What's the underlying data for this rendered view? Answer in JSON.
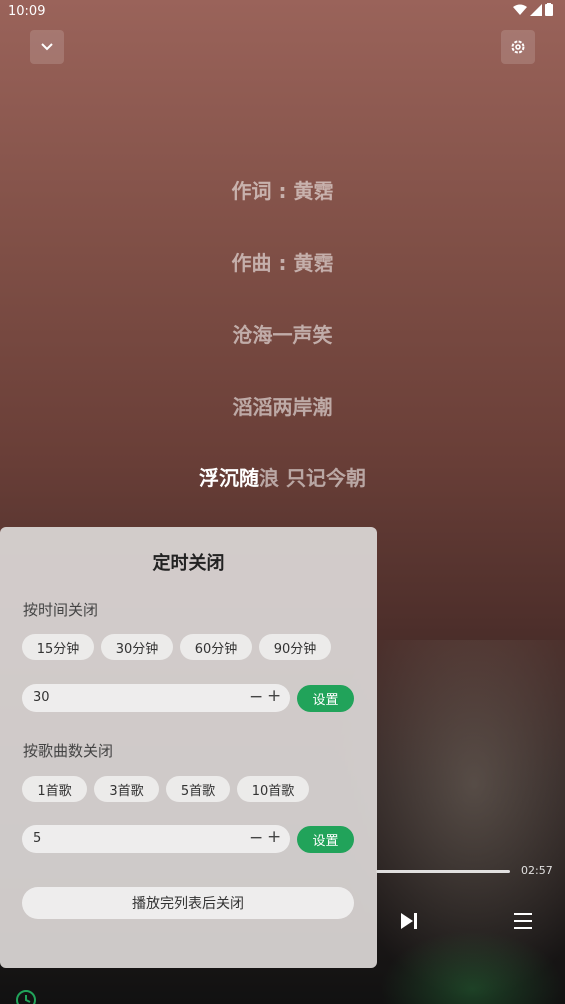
{
  "status_bar": {
    "time": "10:09"
  },
  "lyrics": {
    "lines": [
      "作词 : 黄霑",
      "作曲 : 黄霑",
      "沧海一声笑",
      "滔滔两岸潮"
    ],
    "current_sung": "浮沉随",
    "current_rest": "浪 只记今朝"
  },
  "player": {
    "duration": "02:57"
  },
  "timer_sheet": {
    "title": "定时关闭",
    "by_time": {
      "label": "按时间关闭",
      "chips": [
        "15分钟",
        "30分钟",
        "60分钟",
        "90分钟"
      ],
      "input_value": "30",
      "minus": "−",
      "plus": "+",
      "set_label": "设置"
    },
    "by_songs": {
      "label": "按歌曲数关闭",
      "chips": [
        "1首歌",
        "3首歌",
        "5首歌",
        "10首歌"
      ],
      "input_value": "5",
      "minus": "−",
      "plus": "+",
      "set_label": "设置"
    },
    "close_after_list": "播放完列表后关闭"
  },
  "colors": {
    "accent": "#21a35a"
  }
}
